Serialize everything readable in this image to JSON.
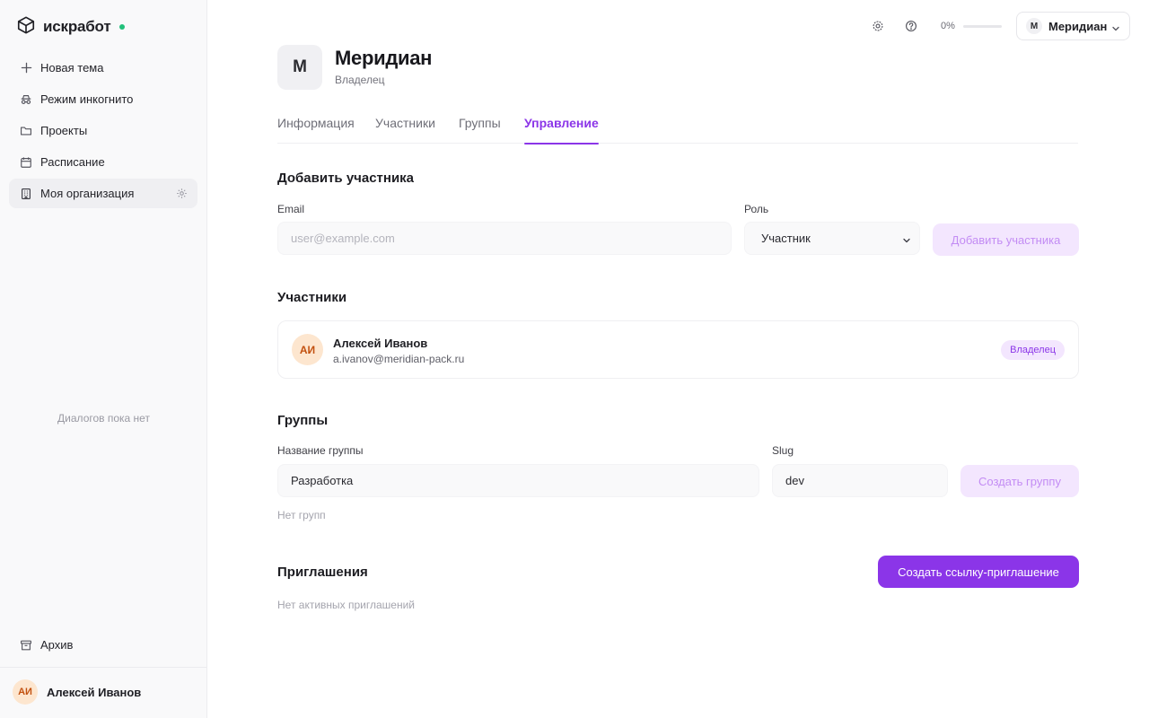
{
  "app": {
    "name": "искработ"
  },
  "sidebar": {
    "items": [
      {
        "label": "Новая тема",
        "icon": "plus-icon"
      },
      {
        "label": "Режим инкогнито",
        "icon": "incognito-icon"
      },
      {
        "label": "Проекты",
        "icon": "folder-icon"
      },
      {
        "label": "Расписание",
        "icon": "calendar-icon"
      },
      {
        "label": "Моя организация",
        "icon": "building-icon",
        "active": true
      }
    ],
    "empty_text": "Диалогов пока нет",
    "archive_label": "Архив",
    "user": {
      "initials": "АИ",
      "name": "Алексей Иванов"
    }
  },
  "topbar": {
    "usage_text": "0%",
    "usage_fraction": 0,
    "org_switch": {
      "initial": "М",
      "label": "Меридиан"
    }
  },
  "org": {
    "initial": "М",
    "name": "Меридиан",
    "role": "Владелец"
  },
  "tabs": [
    {
      "label": "Информация"
    },
    {
      "label": "Участники"
    },
    {
      "label": "Группы"
    },
    {
      "label": "Управление",
      "active": true
    }
  ],
  "add_member": {
    "title": "Добавить участника",
    "email_label": "Email",
    "email_placeholder": "user@example.com",
    "email_value": "",
    "role_label": "Роль",
    "role_value": "Участник",
    "submit_label": "Добавить участника"
  },
  "members": {
    "title": "Участники",
    "list": [
      {
        "initials": "АИ",
        "name": "Алексей Иванов",
        "email": "a.ivanov@meridian-pack.ru",
        "role": "Владелец"
      }
    ]
  },
  "groups": {
    "title": "Группы",
    "name_label": "Название группы",
    "name_value": "Разработка",
    "slug_label": "Slug",
    "slug_value": "dev",
    "submit_label": "Создать группу",
    "empty_text": "Нет групп"
  },
  "invites": {
    "title": "Приглашения",
    "create_label": "Создать ссылку-приглашение",
    "empty_text": "Нет активных приглашений"
  },
  "colors": {
    "accent": "#8b35e8",
    "accent_soft": "#f3e6fe",
    "status_dot": "#22c07a",
    "avatar_bg": "#fde6cf",
    "avatar_fg": "#c2500f"
  }
}
